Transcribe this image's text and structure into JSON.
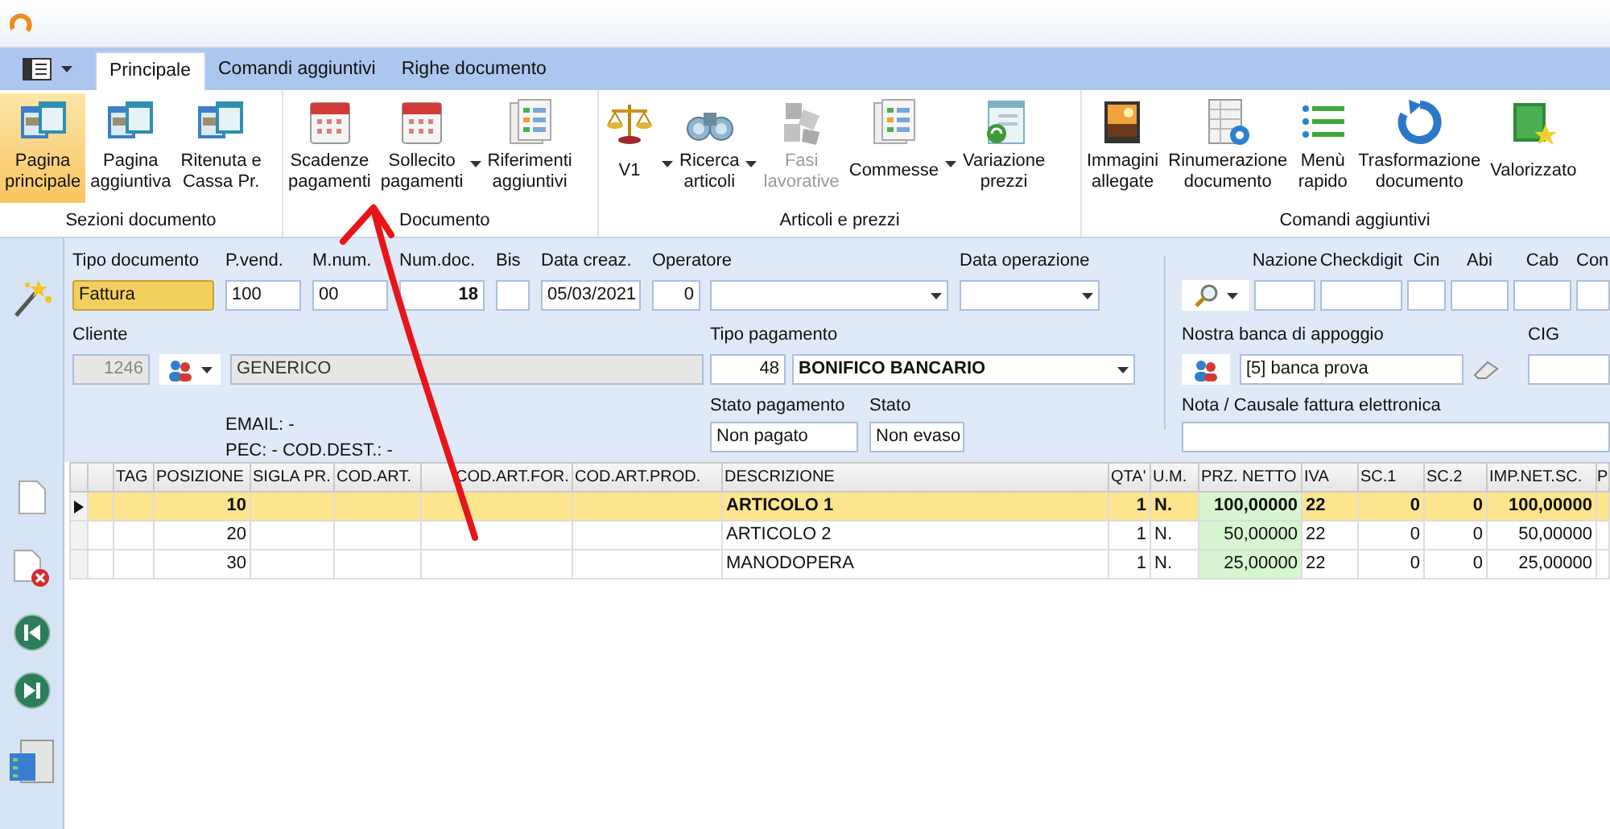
{
  "tabs": [
    {
      "label": "Principale",
      "selected": true
    },
    {
      "label": "Comandi aggiuntivi",
      "selected": false
    },
    {
      "label": "Righe documento",
      "selected": false
    }
  ],
  "ribbon": {
    "groups": [
      {
        "label": "Sezioni documento",
        "items": [
          {
            "lines": [
              "Pagina",
              "principale"
            ],
            "kind": "windows",
            "selected": true,
            "disabled": false,
            "dropdown": false
          },
          {
            "lines": [
              "Pagina",
              "aggiuntiva"
            ],
            "kind": "windows",
            "selected": false,
            "disabled": false,
            "dropdown": false
          },
          {
            "lines": [
              "Ritenuta e",
              "Cassa Pr."
            ],
            "kind": "windows",
            "selected": false,
            "disabled": false,
            "dropdown": false
          }
        ]
      },
      {
        "label": "Documento",
        "items": [
          {
            "lines": [
              "Scadenze",
              "pagamenti"
            ],
            "kind": "calendar",
            "selected": false,
            "disabled": false,
            "dropdown": false
          },
          {
            "lines": [
              "Sollecito",
              "pagamenti"
            ],
            "kind": "calendar",
            "selected": false,
            "disabled": false,
            "dropdown": true
          },
          {
            "lines": [
              "Riferimenti",
              "aggiuntivi"
            ],
            "kind": "checklist",
            "selected": false,
            "disabled": false,
            "dropdown": false
          }
        ]
      },
      {
        "label": "Articoli e prezzi",
        "items": [
          {
            "lines": [
              "V1"
            ],
            "kind": "scales",
            "selected": false,
            "disabled": false,
            "dropdown": true
          },
          {
            "lines": [
              "Ricerca",
              "articoli"
            ],
            "kind": "binoculars",
            "selected": false,
            "disabled": false,
            "dropdown": true
          },
          {
            "lines": [
              "Fasi",
              "lavorative"
            ],
            "kind": "puzzle",
            "selected": false,
            "disabled": true,
            "dropdown": false
          },
          {
            "lines": [
              "Commesse"
            ],
            "kind": "checklist",
            "selected": false,
            "disabled": false,
            "dropdown": true
          },
          {
            "lines": [
              "Variazione",
              "prezzi"
            ],
            "kind": "window",
            "selected": false,
            "disabled": false,
            "dropdown": false
          }
        ]
      },
      {
        "label": "Comandi aggiuntivi",
        "items": [
          {
            "lines": [
              "Immagini",
              "allegate"
            ],
            "kind": "image",
            "selected": false,
            "disabled": false,
            "dropdown": false
          },
          {
            "lines": [
              "Rinumerazione",
              "documento"
            ],
            "kind": "table",
            "selected": false,
            "disabled": false,
            "dropdown": false
          },
          {
            "lines": [
              "Menù",
              "rapido"
            ],
            "kind": "menu",
            "selected": false,
            "disabled": false,
            "dropdown": false
          },
          {
            "lines": [
              "Trasformazione",
              "documento"
            ],
            "kind": "refresh",
            "selected": false,
            "disabled": false,
            "dropdown": false
          },
          {
            "lines": [
              "Valorizzato"
            ],
            "kind": "banknote",
            "selected": false,
            "disabled": false,
            "dropdown": false
          }
        ]
      }
    ]
  },
  "form": {
    "top_fields": [
      {
        "label": "Tipo documento",
        "value": "Fattura",
        "kind": "highlight"
      },
      {
        "label": "P.vend.",
        "value": "100",
        "kind": "text"
      },
      {
        "label": "M.num.",
        "value": "00",
        "kind": "text"
      },
      {
        "label": "Num.doc.",
        "value": "18",
        "kind": "bold-number"
      },
      {
        "label": "Bis",
        "kind": "text"
      },
      {
        "label": "Data creaz.",
        "value": "05/03/2021",
        "kind": "text"
      },
      {
        "label": "Operatore",
        "value": "0",
        "kind": "number-combo"
      },
      {
        "label": "Data operazione",
        "kind": "combo"
      }
    ],
    "cliente": {
      "label": "Cliente",
      "code": "1246",
      "name": "GENERICO",
      "disabled": true
    },
    "tipo_pagamento": {
      "label": "Tipo pagamento",
      "code": "48",
      "value": "BONIFICO BANCARIO"
    },
    "contacts": [
      "EMAIL: -",
      "PEC: - COD.DEST.: -"
    ],
    "stato_pagamento": {
      "label": "Stato pagamento",
      "value": "Non pagato"
    },
    "stato": {
      "label": "Stato",
      "value": "Non evaso"
    },
    "bank_fields": [
      {
        "label": "Nazione"
      },
      {
        "label": "Checkdigit"
      },
      {
        "label": "Cin"
      },
      {
        "label": "Abi"
      },
      {
        "label": "Cab"
      },
      {
        "label": "Con"
      }
    ],
    "bank": {
      "label": "Nostra banca di appoggio",
      "value": "[5] banca prova"
    },
    "cig": {
      "label": "CIG"
    },
    "nota": {
      "label": "Nota / Causale fattura elettronica"
    }
  },
  "table": {
    "columns": [
      "TAG",
      "POSIZIONE",
      "SIGLA PR.",
      "COD.ART.",
      "COD.ART.FOR.",
      "COD.ART.PROD.",
      "DESCRIZIONE",
      "QTA'",
      "U.M.",
      "PRZ. NETTO",
      "IVA",
      "SC.1",
      "SC.2",
      "IMP.NET.SC.",
      "P"
    ],
    "rows": [
      {
        "selected": true,
        "posizione": "10",
        "descrizione": "ARTICOLO 1",
        "qta": "1",
        "um": "N.",
        "prz_netto": "100,00000",
        "iva": "22",
        "sc1": "0",
        "sc2": "0",
        "imp_net_sc": "100,00000"
      },
      {
        "selected": false,
        "posizione": "20",
        "descrizione": "ARTICOLO 2",
        "qta": "1",
        "um": "N.",
        "prz_netto": "50,00000",
        "iva": "22",
        "sc1": "0",
        "sc2": "0",
        "imp_net_sc": "50,00000"
      },
      {
        "selected": false,
        "posizione": "30",
        "descrizione": "MANODOPERA",
        "qta": "1",
        "um": "N.",
        "prz_netto": "25,00000",
        "iva": "22",
        "sc1": "0",
        "sc2": "0",
        "imp_net_sc": "25,00000"
      }
    ]
  }
}
